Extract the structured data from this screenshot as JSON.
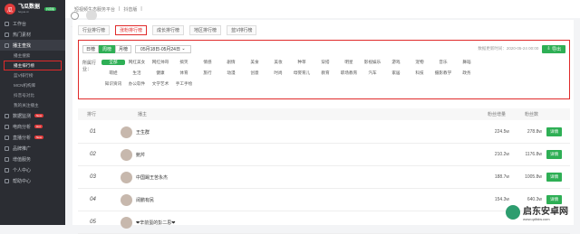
{
  "logo": {
    "title": "飞瓜数据",
    "sub": "feigua.cn",
    "badge": "抖音版"
  },
  "sidebar": {
    "items": [
      {
        "label": "工作台"
      },
      {
        "label": "热门素材"
      },
      {
        "label": "播主查找",
        "active": true
      }
    ],
    "subs": [
      {
        "label": "播主搜索"
      },
      {
        "label": "播主排行榜",
        "current": true
      },
      {
        "label": "蓝V排行榜"
      },
      {
        "label": "MCN机构库"
      },
      {
        "label": "抖音号对比"
      },
      {
        "label": "我的关注播主"
      }
    ],
    "more": [
      {
        "label": "数据监测",
        "badge": "New"
      },
      {
        "label": "电商分析",
        "badge": "Hot"
      },
      {
        "label": "直播分析",
        "badge": "New"
      },
      {
        "label": "品牌推广"
      },
      {
        "label": "增值服务"
      },
      {
        "label": "个人中心"
      },
      {
        "label": "帮助中心"
      }
    ]
  },
  "topbar": {
    "crumbs": [
      "短视频生态服务平台",
      "|",
      "抖音版",
      "|"
    ]
  },
  "tabs": [
    "行业排行榜",
    "涨粉排行榜",
    "成长排行榜",
    "地区排行榜",
    "蓝V排行榜"
  ],
  "filter": {
    "periods": [
      "日榜",
      "周榜",
      "月榜"
    ],
    "active_period": "周榜",
    "date": "05月18日-05月24日",
    "update": "数据更新时间：2020-05-24 00:00",
    "export": "导出",
    "cat_label": "所属行业：",
    "cats": [
      "全部",
      "网红美女",
      "网红帅哥",
      "搞笑",
      "情感",
      "剧情",
      "美食",
      "美妆",
      "种草",
      "穿搭",
      "明星",
      "影视娱乐",
      "游戏",
      "宠物",
      "音乐",
      "舞蹈",
      "萌娃",
      "生活",
      "健康",
      "体育",
      "旅行",
      "动漫",
      "创意",
      "时尚",
      "母婴育儿",
      "教育",
      "职场教育",
      "汽车",
      "家居",
      "科技",
      "摄影教学",
      "政务",
      "知识资讯",
      "办公软件",
      "文学艺术",
      "手工手绘"
    ]
  },
  "table": {
    "headers": [
      "排行",
      "播主",
      "粉丝增量",
      "粉丝数"
    ],
    "rows": [
      {
        "rank": "01",
        "name": "王生群",
        "inc": "224.5w",
        "fans": "278.8w",
        "btn": "详情"
      },
      {
        "rank": "02",
        "name": "鲍芹",
        "inc": "210.2w",
        "fans": "1176.8w",
        "btn": "详情"
      },
      {
        "rank": "03",
        "name": "中国踢王苦永杰",
        "inc": "188.7w",
        "fans": "1005.8w",
        "btn": "详情"
      },
      {
        "rank": "04",
        "name": "阔鹏有民",
        "inc": "154.3w",
        "fans": "640.3w",
        "btn": "详情"
      },
      {
        "rank": "05",
        "name": "❤辛前蛋的彭二思❤",
        "inc": "",
        "fans": "",
        "btn": ""
      }
    ]
  },
  "watermark": {
    "t1": "启东安卓网",
    "t2": "www.qdltdw.com"
  }
}
